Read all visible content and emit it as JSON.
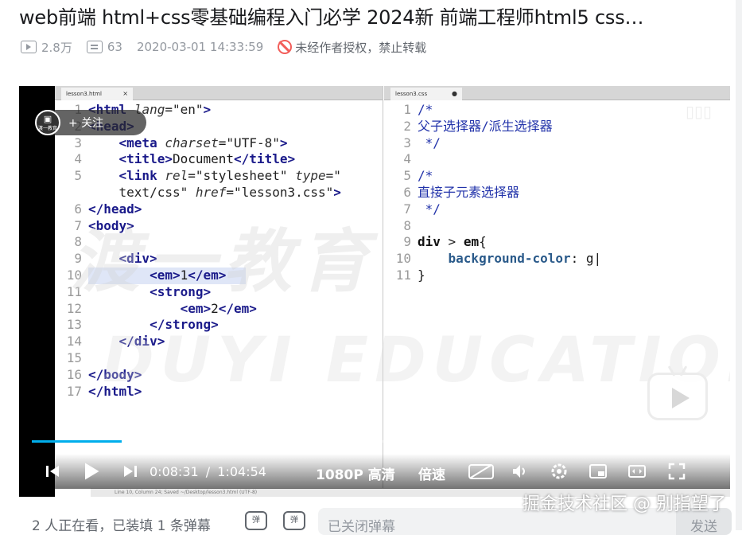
{
  "video": {
    "title": "web前端 html+css零基础编程入门必学 2024新 前端工程师html5 css…",
    "views": "2.8万",
    "danmaku_count": "63",
    "publish_time": "2020-03-01 14:33:59",
    "copyright_notice": "未经作者授权，禁止转载"
  },
  "editor": {
    "left_tab": "lesson3.html",
    "right_tab": "lesson3.css",
    "status_bar": "Line 10, Column 24; Saved ~/Desktop/lesson3.html (UTF-8)",
    "watermark_cn": "渡一教育",
    "watermark_en": "DUYI EDUCATION",
    "html_lines": [
      {
        "n": "1",
        "html": "<span class=\"tg\">&lt;html</span> <span class=\"at\">lang</span>=<span class=\"st\">\"en\"</span><span class=\"tg\">&gt;</span>"
      },
      {
        "n": "2",
        "html": "<span class=\"tg\">&lt;head&gt;</span>"
      },
      {
        "n": "3",
        "html": "    <span class=\"tg\">&lt;meta</span> <span class=\"at\">charset</span>=<span class=\"st\">\"UTF-8\"</span><span class=\"tg\">&gt;</span>"
      },
      {
        "n": "4",
        "html": "    <span class=\"tg\">&lt;title&gt;</span>Document<span class=\"tg\">&lt;/title&gt;</span>"
      },
      {
        "n": "5",
        "html": "    <span class=\"tg\">&lt;link</span> <span class=\"at\">rel</span>=<span class=\"st\">\"stylesheet\"</span> <span class=\"at\">type</span>=<span class=\"st\">\"</span>"
      },
      {
        "n": "",
        "html": "    <span class=\"st\">text/css\"</span> <span class=\"at\">href</span>=<span class=\"st\">\"lesson3.css\"</span><span class=\"tg\">&gt;</span>"
      },
      {
        "n": "6",
        "html": "<span class=\"tg\">&lt;/head&gt;</span>"
      },
      {
        "n": "7",
        "html": "<span class=\"tg\">&lt;body&gt;</span>"
      },
      {
        "n": "8",
        "html": ""
      },
      {
        "n": "9",
        "html": "    <span class=\"tg\">&lt;div&gt;</span>"
      },
      {
        "n": "10",
        "html": "        <span class=\"tg\">&lt;em&gt;</span>1<span class=\"tg\">&lt;/em&gt;</span>",
        "highlight": true
      },
      {
        "n": "11",
        "html": "        <span class=\"tg\">&lt;strong&gt;</span>"
      },
      {
        "n": "12",
        "html": "            <span class=\"tg\">&lt;em&gt;</span>2<span class=\"tg\">&lt;/em&gt;</span>"
      },
      {
        "n": "13",
        "html": "        <span class=\"tg\">&lt;/strong&gt;</span>"
      },
      {
        "n": "14",
        "html": "    <span class=\"tg\">&lt;/div&gt;</span>"
      },
      {
        "n": "15",
        "html": ""
      },
      {
        "n": "16",
        "html": "<span class=\"tg\">&lt;/body&gt;</span>"
      },
      {
        "n": "17",
        "html": "<span class=\"tg\">&lt;/html&gt;</span>"
      }
    ],
    "css_lines": [
      {
        "n": "1",
        "html": "<span class=\"cm\">/*</span>"
      },
      {
        "n": "2",
        "html": "<span class=\"cm\">父子选择器/派生选择器</span>"
      },
      {
        "n": "3",
        "html": "<span class=\"cm\"> */</span>"
      },
      {
        "n": "4",
        "html": ""
      },
      {
        "n": "5",
        "html": "<span class=\"cm\">/*</span>"
      },
      {
        "n": "6",
        "html": "<span class=\"cm\">直接子元素选择器</span>"
      },
      {
        "n": "7",
        "html": "<span class=\"cm\"> */</span>"
      },
      {
        "n": "8",
        "html": ""
      },
      {
        "n": "9",
        "html": "<span class=\"kw\">div</span> &gt; <span class=\"kw\">em</span>{"
      },
      {
        "n": "10",
        "html": "    <span class=\"prop\">background-color</span>: g|"
      },
      {
        "n": "11",
        "html": "}"
      }
    ]
  },
  "player": {
    "uploader_follow": "+ 关注",
    "uploader_avatar_text": "渡一教育",
    "current_time": "0:08:31",
    "separator": "/",
    "duration": "1:04:54",
    "quality": "1080P 高清",
    "speed": "倍速",
    "progress_fraction": 0.131,
    "buffer_fraction": 0.155,
    "accent_color": "#00aeec",
    "icons": [
      "prev-icon",
      "play-icon",
      "next-icon",
      "danmaku-off-icon",
      "volume-icon",
      "settings-icon",
      "pip-icon",
      "widescreen-icon",
      "fullscreen-icon"
    ]
  },
  "bottom": {
    "viewers": "2 人正在看，已装填 1 条弹幕",
    "danmu_placeholder": "已关闭弹幕",
    "send": "发送",
    "overlay_watermark": "掘金技术社区 @ 别指望了"
  }
}
